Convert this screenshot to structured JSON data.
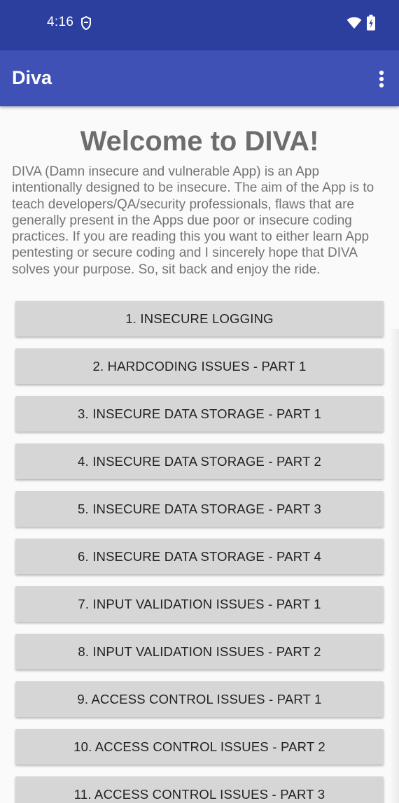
{
  "status_bar": {
    "time": "4:16",
    "notification_icon": "shield-notification-icon",
    "wifi_icon": "wifi-icon",
    "battery_icon": "battery-charging-icon",
    "color": "#2c3e9e"
  },
  "app_bar": {
    "title": "Diva",
    "menu_icon": "more-vert-icon",
    "color": "#3f51b5"
  },
  "main": {
    "welcome_title": "Welcome to DIVA!",
    "intro": "DIVA (Damn insecure and vulnerable App) is an App intentionally designed to be insecure. The aim of the App is to teach developers/QA/security professionals, flaws that are generally present in the Apps due poor or insecure coding practices. If you are reading this you want to either learn App pentesting or secure coding and I sincerely hope that DIVA solves your purpose. So, sit back and enjoy the ride.",
    "buttons": [
      "1. INSECURE LOGGING",
      "2. HARDCODING ISSUES - PART 1",
      "3. INSECURE DATA STORAGE - PART 1",
      "4. INSECURE DATA STORAGE - PART 2",
      "5. INSECURE DATA STORAGE - PART 3",
      "6. INSECURE DATA STORAGE - PART 4",
      "7. INPUT VALIDATION ISSUES - PART 1",
      "8. INPUT VALIDATION ISSUES - PART 2",
      "9. ACCESS CONTROL ISSUES - PART 1",
      "10. ACCESS CONTROL ISSUES - PART 2",
      "11. ACCESS CONTROL ISSUES - PART 3"
    ]
  }
}
